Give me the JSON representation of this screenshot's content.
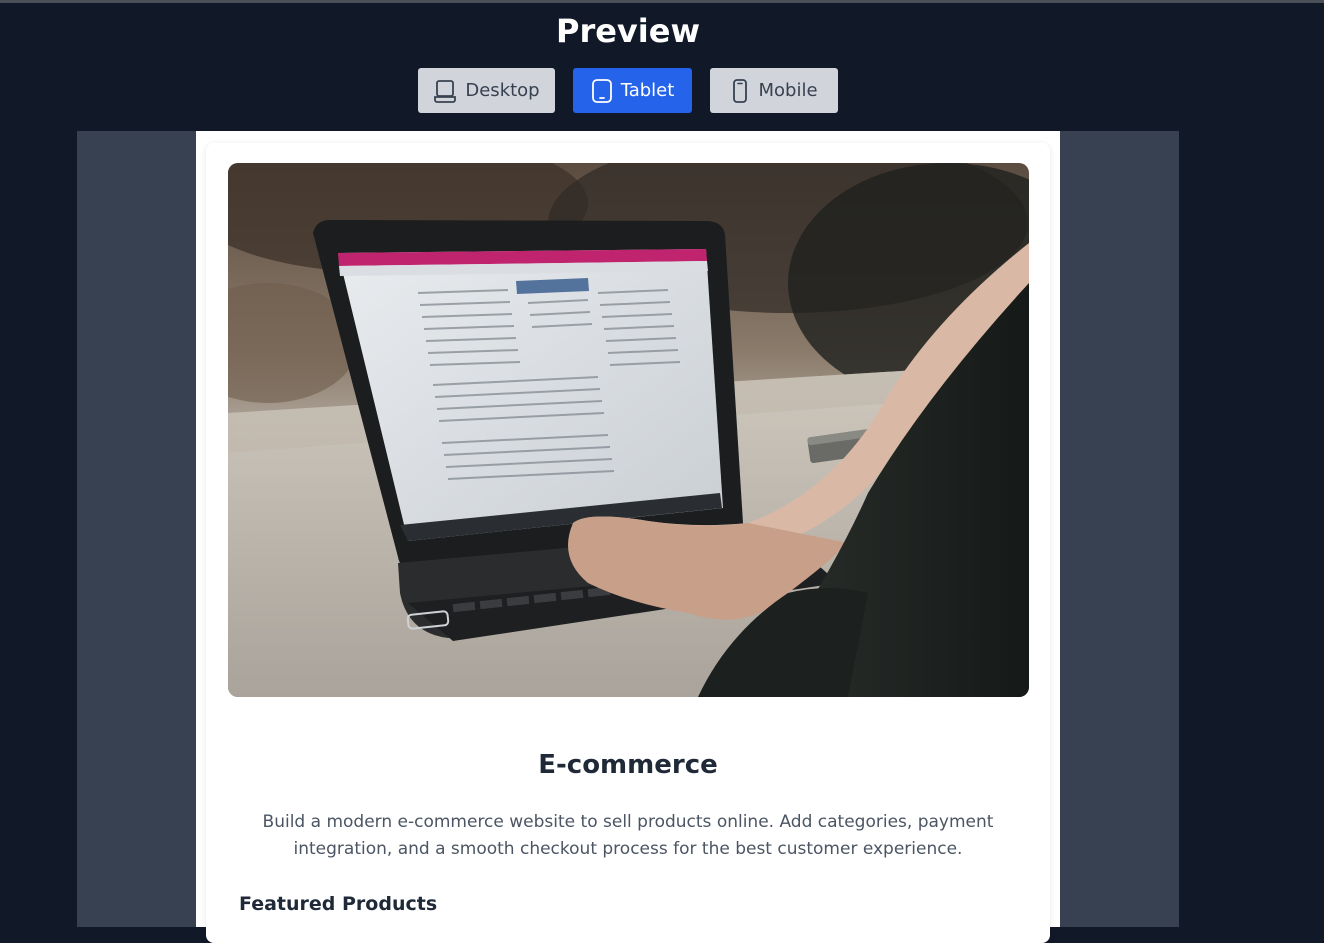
{
  "header": {
    "title": "Preview"
  },
  "device_buttons": [
    {
      "label": "Desktop",
      "icon": "laptop-icon",
      "active": false
    },
    {
      "label": "Tablet",
      "icon": "tablet-icon",
      "active": true
    },
    {
      "label": "Mobile",
      "icon": "mobile-icon",
      "active": false
    }
  ],
  "card": {
    "image_alt_icon": "laptop-photo",
    "title": "E-commerce",
    "description": "Build a modern e-commerce website to sell products online. Add categories, payment integration, and a smooth checkout process for the best customer experience.",
    "section_heading": "Featured Products"
  },
  "colors": {
    "page_background": "#111827",
    "stage_background": "#374151",
    "active_button": "#2563eb",
    "inactive_button": "#d1d5db"
  }
}
